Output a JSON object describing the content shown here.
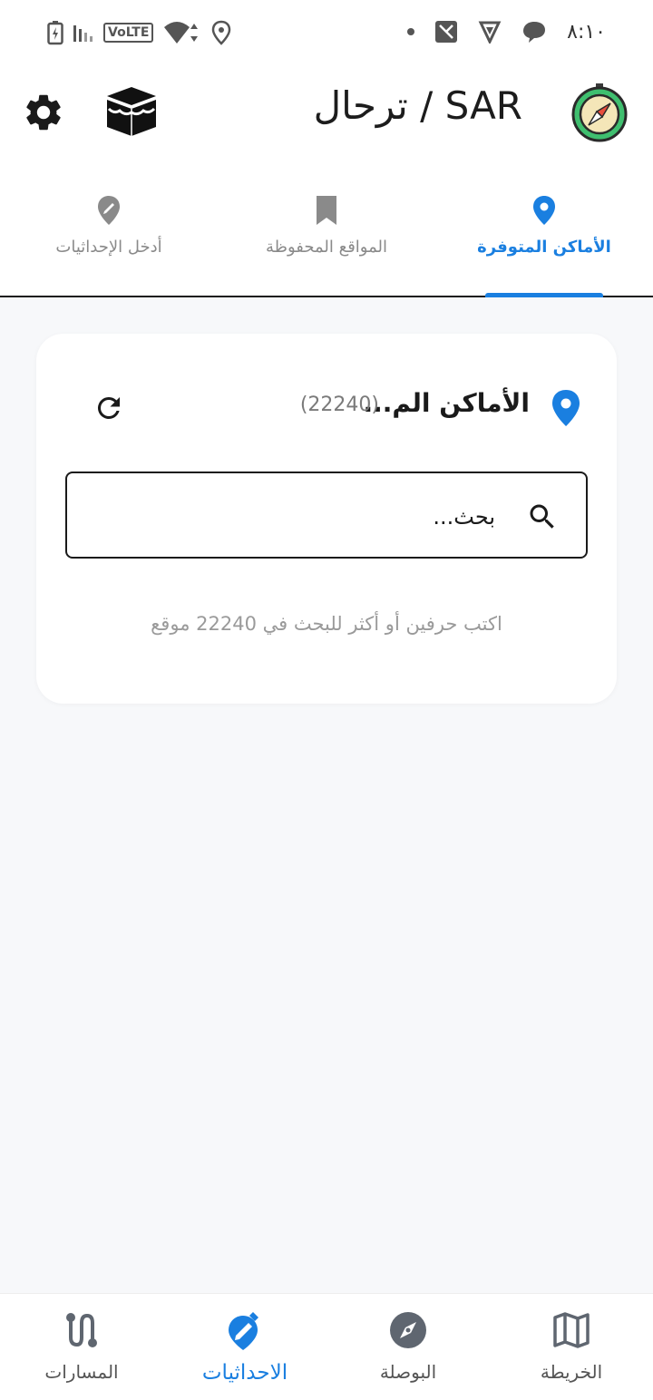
{
  "status_bar": {
    "time": "٨:١٠",
    "network_badge": "VoLTE",
    "icons": [
      "battery-charging-icon",
      "signal-icon",
      "volte-icon",
      "wifi-icon",
      "location-icon",
      "dot-icon",
      "image-icon",
      "vpn-icon",
      "chat-icon"
    ]
  },
  "app_bar": {
    "title": "SAR / ترحال",
    "logo_icon": "compass-logo-icon",
    "kaaba_icon": "kaaba-icon",
    "settings_icon": "gear-icon"
  },
  "tabs": [
    {
      "label": "الأماكن المتوفرة",
      "icon": "location-pin-icon",
      "active": true
    },
    {
      "label": "المواقع المحفوظة",
      "icon": "bookmark-icon",
      "active": false
    },
    {
      "label": "أدخل الإحداثيات",
      "icon": "edit-pin-icon",
      "active": false
    }
  ],
  "card": {
    "title": "الأماكن الم...",
    "count": "(22240)",
    "search_placeholder": "بحث...",
    "hint": "اكتب حرفين أو أكثر للبحث في 22240 موقع"
  },
  "bottom_nav": [
    {
      "label": "الخريطة",
      "icon": "map-icon",
      "active": false
    },
    {
      "label": "البوصلة",
      "icon": "compass-icon",
      "active": false
    },
    {
      "label": "الاحداثيات",
      "icon": "edit-location-icon",
      "active": true
    },
    {
      "label": "المسارات",
      "icon": "route-icon",
      "active": false
    }
  ],
  "colors": {
    "accent": "#1a7fe0",
    "text_dark": "#1a1a1a",
    "muted": "#8a8a8a",
    "background": "#f7f8fa"
  }
}
